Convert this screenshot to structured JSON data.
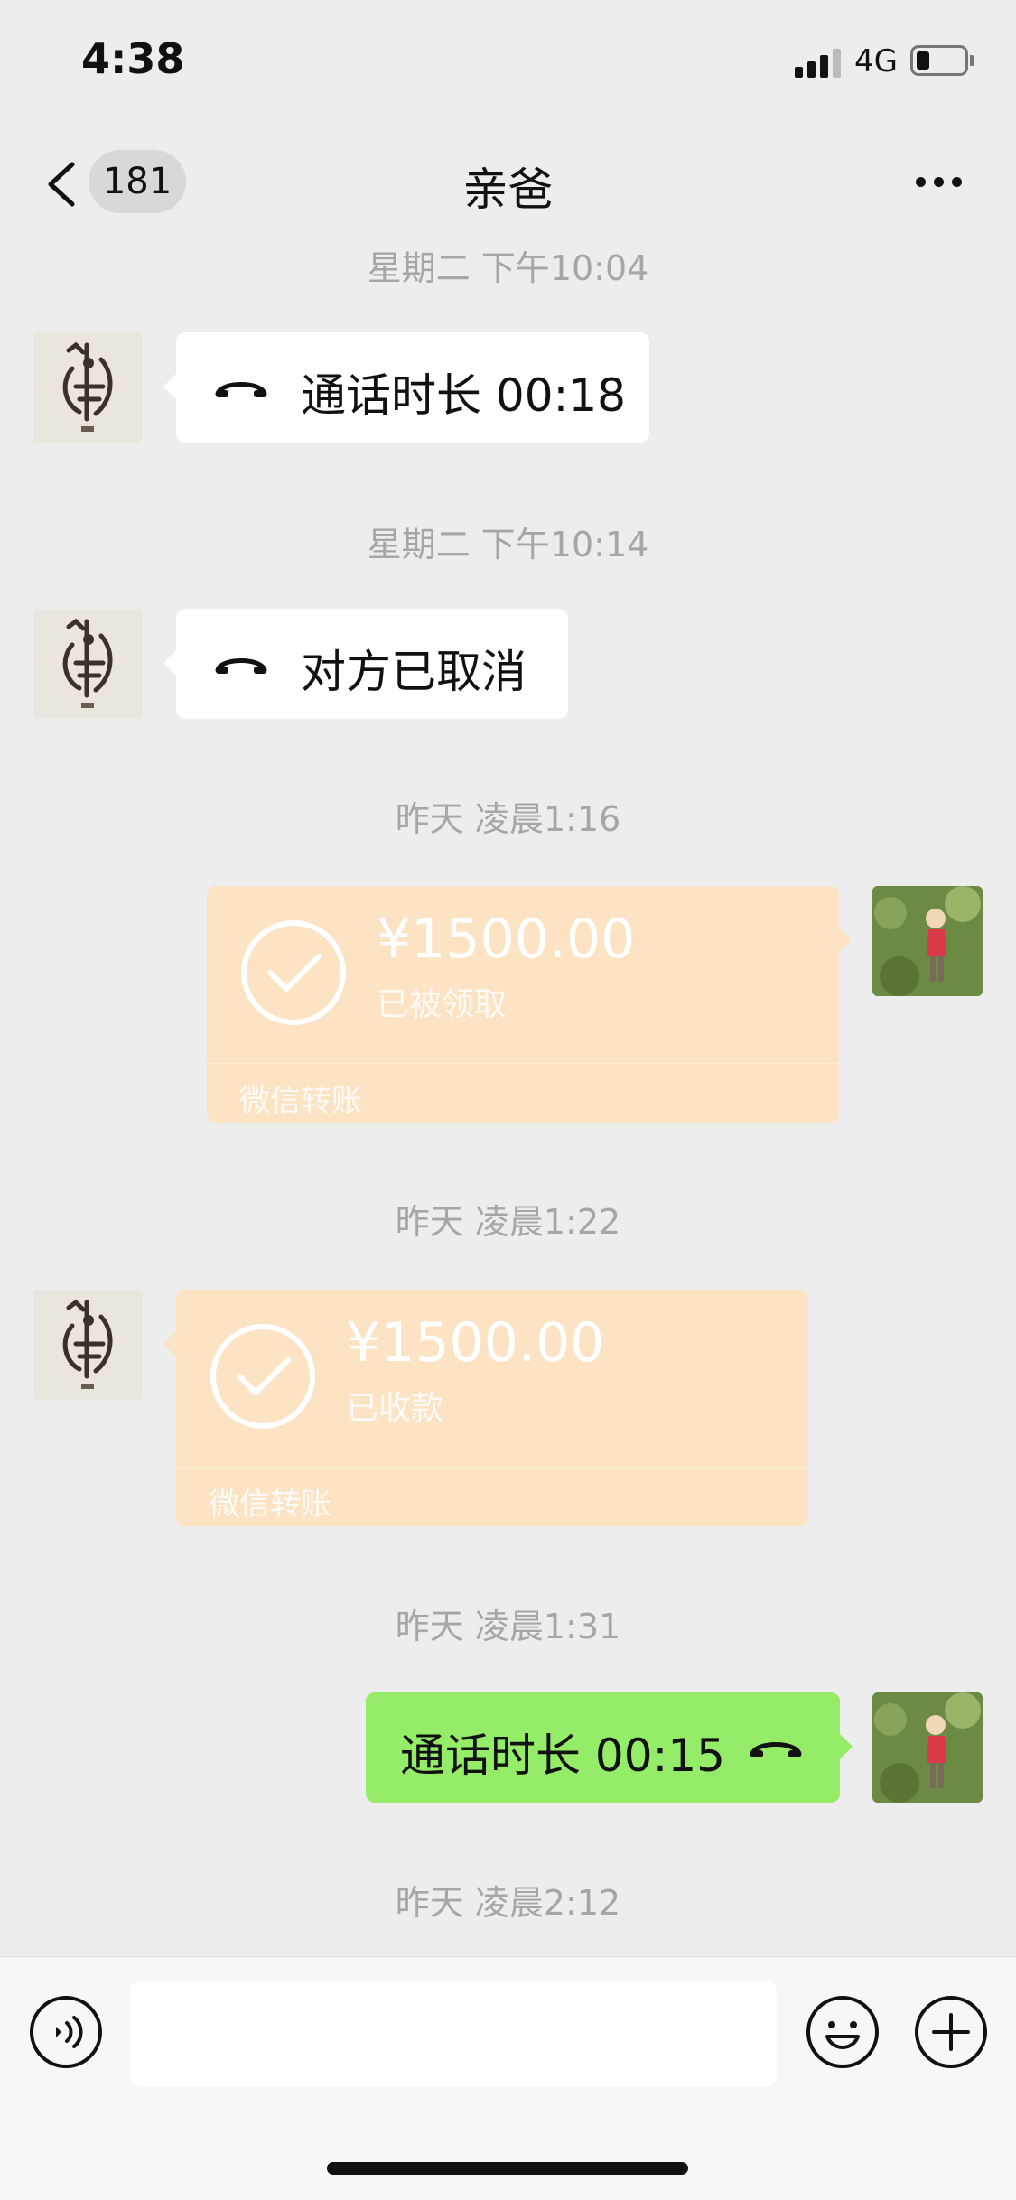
{
  "status_bar": {
    "time": "4:38",
    "network": "4G",
    "battery_level": 0.25
  },
  "nav": {
    "back_count": "181",
    "title": "亲爸",
    "back_icon": "chevron-left-icon",
    "more_icon": "more-icon"
  },
  "messages": [
    {
      "timestamp": "星期二 下午10:04",
      "sender": "father",
      "type": "call",
      "text": "通话时长 00:18"
    },
    {
      "timestamp": "星期二 下午10:14",
      "sender": "father",
      "type": "call",
      "text": "对方已取消"
    },
    {
      "timestamp": "昨天 凌晨1:16",
      "sender": "self",
      "type": "transfer",
      "amount": "¥1500.00",
      "status": "已被领取",
      "label": "微信转账"
    },
    {
      "timestamp": "昨天 凌晨1:22",
      "sender": "father",
      "type": "transfer",
      "amount": "¥1500.00",
      "status": "已收款",
      "label": "微信转账"
    },
    {
      "timestamp": "昨天 凌晨1:31",
      "sender": "self",
      "type": "call",
      "text": "通话时长 00:15"
    },
    {
      "timestamp": "昨天 凌晨2:12"
    }
  ],
  "input_bar": {
    "voice_icon": "voice-icon",
    "emoji_icon": "emoji-icon",
    "plus_icon": "plus-icon",
    "input_value": ""
  },
  "colors": {
    "background": "#ededed",
    "sent_bubble": "#95ec69",
    "received_bubble": "#ffffff",
    "transfer": "#fce3c4",
    "timestamp": "#a6a6a6"
  }
}
